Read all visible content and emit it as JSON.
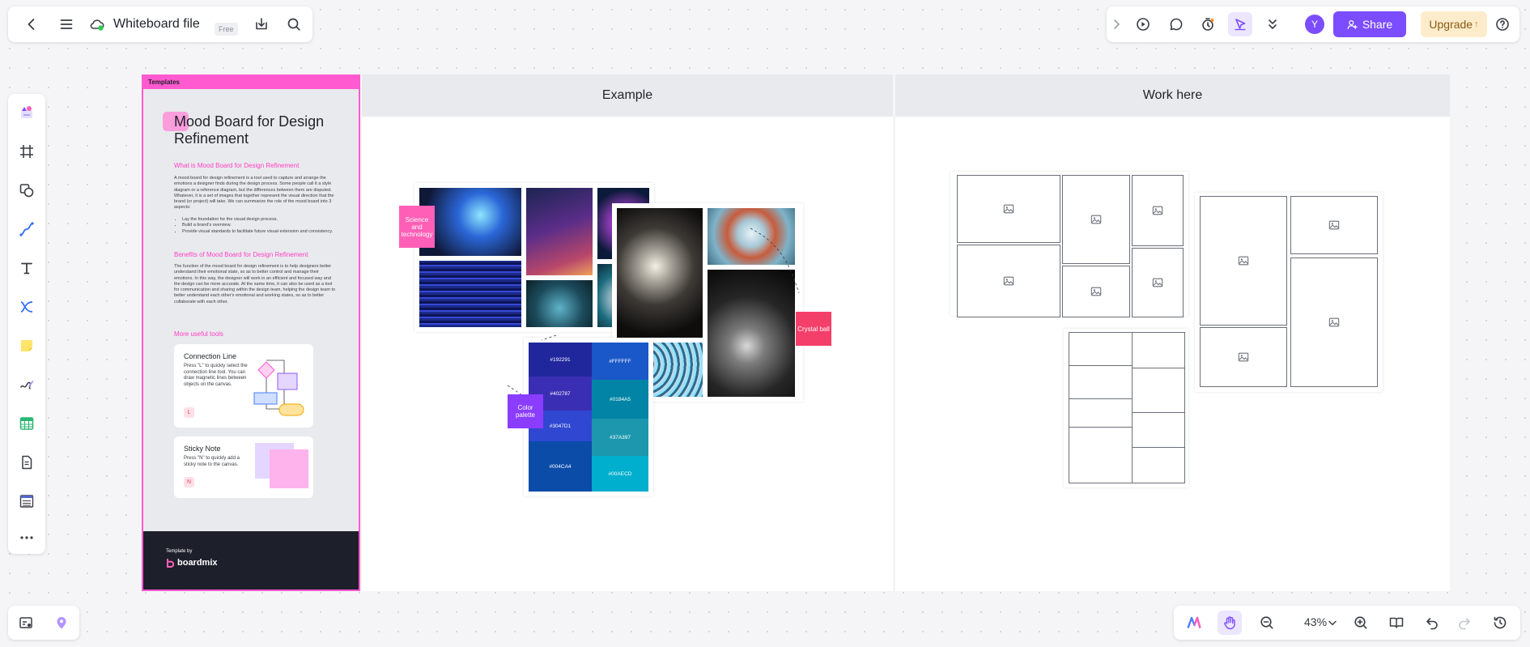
{
  "header": {
    "file_title": "Whiteboard file",
    "plan_badge": "Free",
    "share_label": "Share",
    "upgrade_label": "Upgrade",
    "avatar_initial": "Y"
  },
  "left_toolbar": {
    "tools": [
      "templates-icon",
      "frame-icon",
      "shapes-icon",
      "pen-curve-icon",
      "text-icon",
      "connector-icon",
      "sticky-note-icon",
      "draw-icon",
      "table-icon",
      "document-icon",
      "list-icon",
      "more-icon"
    ]
  },
  "bottom_toolbar": {
    "zoom": "43%"
  },
  "template_panel": {
    "strip_label": "Templates",
    "title": "Mood Board for Design Refinement",
    "h1": "What is Mood Board for Design Refinement",
    "p1": "A mood board for design refinement is a tool used to capture and arrange the emotions a designer finds during the design process. Some people call it a style diagram or a reference diagram, but the differences between them are disputed. Whatever, it is a set of images that together represent the visual direction that the brand (or project) will take. We can summarize the role of the mood board into 3 aspects:",
    "bullets": [
      "Lay the foundation for the visual design process.",
      "Build a brand's overview.",
      "Provide visual standards to facilitate future visual extension and consistency."
    ],
    "h2": "Benefits of Mood Board for Design Refinement",
    "p2": "The function of the mood board for design refinement is to help designers better understand their emotional state, so as to better control and manage their emotions. In this way, the designer will work in an efficient and focused way and the design can be more accurate. At the same time, it can also be used as a tool for communication and sharing within the design team, helping the design team to better understand each other's emotional and working states, so as to better collaborate with each other.",
    "h3": "More useful tools",
    "card1": {
      "title": "Connection Line",
      "desc": "Press \"L\" to quickly select the connection line tool. You can draw magnetic lines between objects on the canvas.",
      "key": "L"
    },
    "card2": {
      "title": "Sticky Note",
      "desc": "Press \"N\" to quickly add a sticky note to the canvas.",
      "key": "N"
    },
    "footer_by": "Template by",
    "footer_brand": "boardmix"
  },
  "frames": {
    "example_title": "Example",
    "work_title": "Work here"
  },
  "stickies": {
    "science": "Science and technology",
    "crystal": "Crystal ball",
    "color": "Color palette"
  },
  "palette": {
    "left": [
      {
        "label": "#192291",
        "color": "#20279c"
      },
      {
        "label": "#402787",
        "color": "#3a2fb4"
      },
      {
        "label": "#3047D1",
        "color": "#3047d1"
      },
      {
        "label": "#004CA4",
        "color": "#0b4ca8"
      }
    ],
    "right": [
      {
        "label": "#FFFFFF",
        "color": "#1a57c8"
      },
      {
        "label": "#0184A5",
        "color": "#0184a5"
      },
      {
        "label": "#37A397",
        "color": "#1d97ad"
      },
      {
        "label": "#00AECD",
        "color": "#00aecd"
      }
    ]
  },
  "colors": {
    "accent": "#7c4dff",
    "template_pink": "#ff5ad0",
    "sticky_pink": "#ff5fb7",
    "sticky_red": "#f43f6a",
    "sticky_purple": "#8a3cff"
  }
}
